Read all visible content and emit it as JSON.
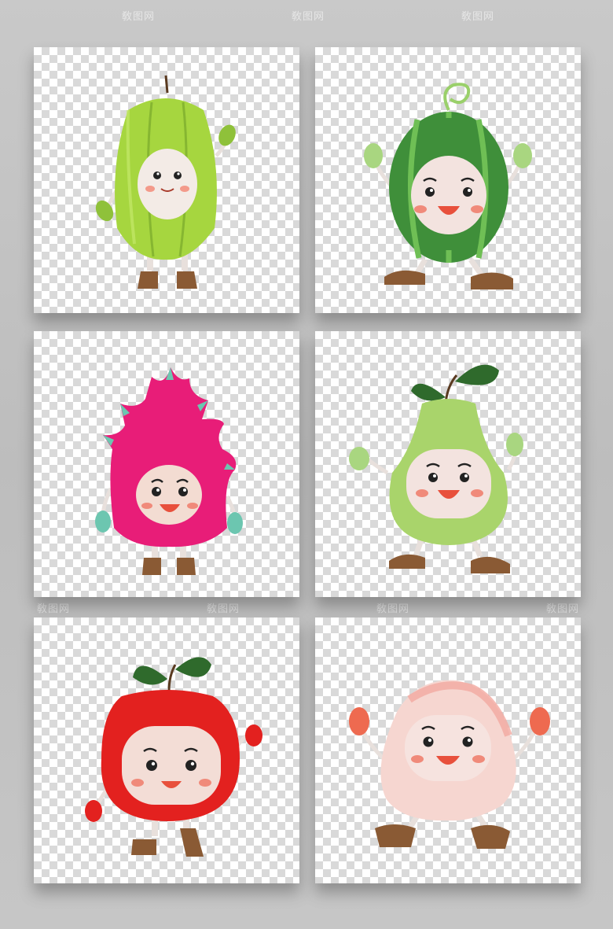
{
  "watermark": "敎图网",
  "characters": [
    {
      "id": "star-fruit",
      "body_color": "#9acd3a"
    },
    {
      "id": "watermelon",
      "body_color": "#3f8f3a"
    },
    {
      "id": "dragon-fruit",
      "body_color": "#e81d78"
    },
    {
      "id": "pear",
      "body_color": "#a9d46b"
    },
    {
      "id": "apple",
      "body_color": "#e3211f"
    },
    {
      "id": "peach",
      "body_color": "#f7d3cd"
    }
  ]
}
